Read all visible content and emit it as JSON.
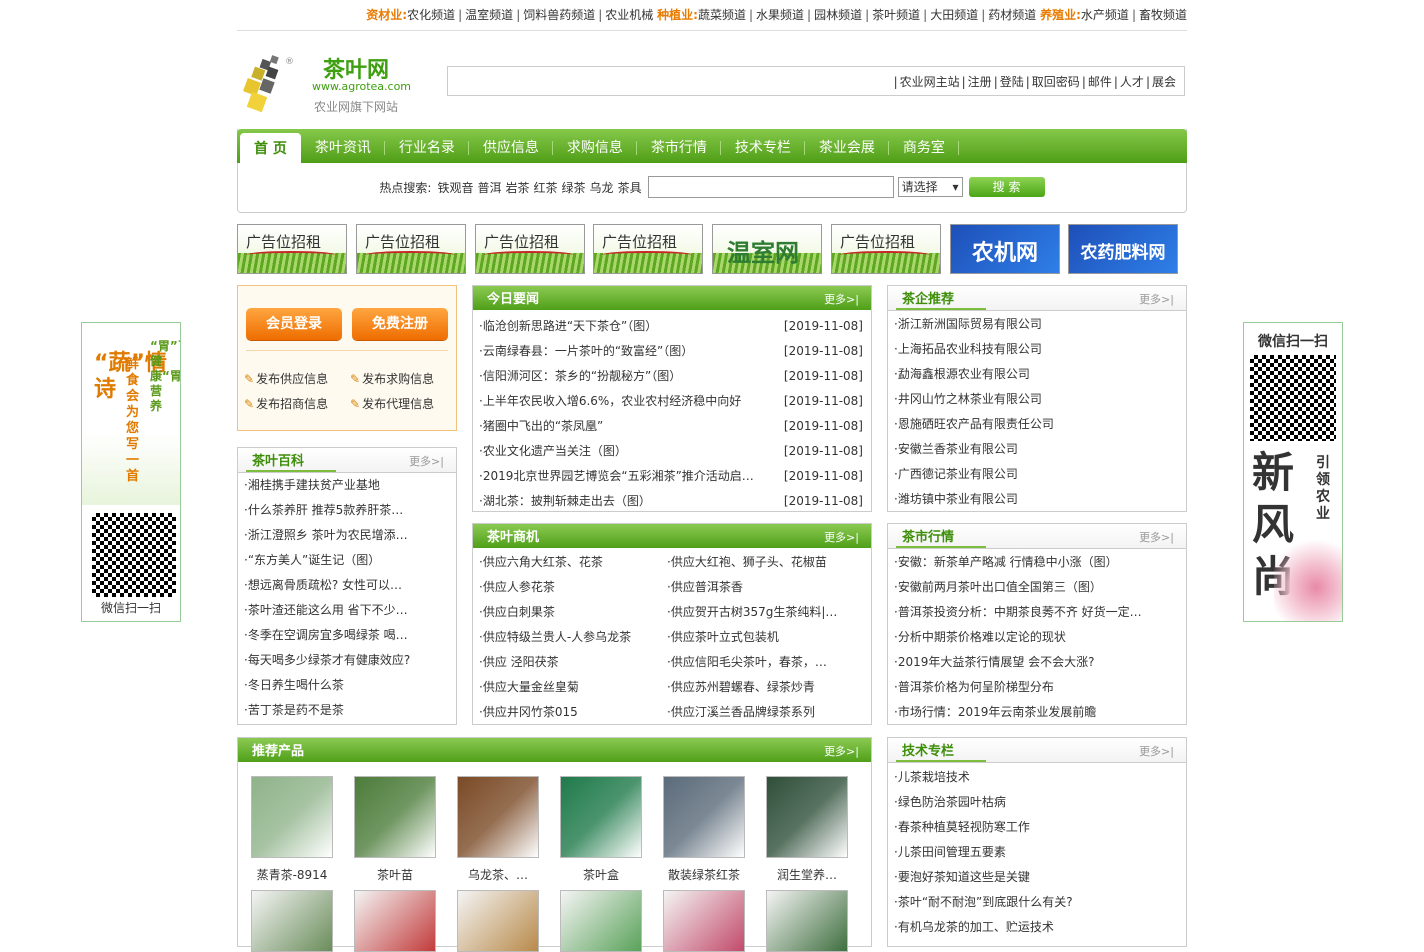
{
  "topbar": {
    "groups": [
      {
        "label": "资材业:",
        "items": [
          "农化频道",
          "温室频道",
          "饲料兽药频道",
          "农业机械"
        ]
      },
      {
        "label": "种植业:",
        "items": [
          "蔬菜频道",
          "水果频道",
          "园林频道",
          "茶叶频道",
          "大田频道",
          "药材频道"
        ]
      },
      {
        "label": "养殖业:",
        "items": [
          "水产频道",
          "畜牧频道"
        ]
      }
    ]
  },
  "header": {
    "title": "茶叶网",
    "url": "www.agrotea.com",
    "subtitle": "农业网旗下网站",
    "reg_mark": "®",
    "links": [
      "农业网主站",
      "注册",
      "登陆",
      "取回密码",
      "邮件",
      "人才",
      "展会"
    ]
  },
  "nav": {
    "items": [
      "首 页",
      "茶叶资讯",
      "行业名录",
      "供应信息",
      "求购信息",
      "茶市行情",
      "技术专栏",
      "茶业会展",
      "商务室"
    ],
    "hot_label": "热点搜索:",
    "hot_keywords": [
      "铁观音",
      "普洱",
      "岩茶",
      "红茶",
      "绿茶",
      "乌龙",
      "茶具"
    ],
    "search_value": "",
    "select_value": "请选择",
    "search_button": "搜 索"
  },
  "ads": [
    {
      "text": "广告位招租",
      "style": "green"
    },
    {
      "text": "广告位招租",
      "style": "green"
    },
    {
      "text": "广告位招租",
      "style": "green"
    },
    {
      "text": "广告位招租",
      "style": "green"
    },
    {
      "text": "温室网",
      "style": "wenshi"
    },
    {
      "text": "广告位招租",
      "style": "green"
    },
    {
      "text": "农机网",
      "style": "blue"
    },
    {
      "text": "农药肥料网",
      "style": "blue2"
    }
  ],
  "login": {
    "login_button": "会员登录",
    "register_button": "免费注册",
    "links": [
      "发布供应信息",
      "发布求购信息",
      "发布招商信息",
      "发布代理信息"
    ]
  },
  "more": "更多>|",
  "news": {
    "title": "今日要闻",
    "items": [
      {
        "t": "·临沧创新思路进“天下茶仓”（图）",
        "d": "[2019-11-08]"
      },
      {
        "t": "·云南绿春县：一片茶叶的“致富经”（图）",
        "d": "[2019-11-08]"
      },
      {
        "t": "·信阳浉河区：茶乡的“扮靓秘方”（图）",
        "d": "[2019-11-08]"
      },
      {
        "t": "·上半年农民收入增6.6%，农业农村经济稳中向好",
        "d": "[2019-11-08]"
      },
      {
        "t": "·猪圈中飞出的“茶凤凰”",
        "d": "[2019-11-08]"
      },
      {
        "t": "·农业文化遗产当关注（图）",
        "d": "[2019-11-08]"
      },
      {
        "t": "·2019北京世界园艺博览会“五彩湘茶”推介活动启…",
        "d": "[2019-11-08]"
      },
      {
        "t": "·湖北茶：披荆斩棘走出去（图）",
        "d": "[2019-11-08]"
      }
    ]
  },
  "enterprises": {
    "title": "茶企推荐",
    "items": [
      "·浙江新洲国际贸易有限公司",
      "·上海拓品农业科技有限公司",
      "·勐海鑫根源农业有限公司",
      "·井冈山竹之林茶业有限公司",
      "·恩施硒旺农产品有限责任公司",
      "·安徽兰香茶业有限公司",
      "·广西德记茶业有限公司",
      "·潍坊镇中茶业有限公司"
    ]
  },
  "encyclopedia": {
    "title": "茶叶百科",
    "items": [
      "·湘桂携手建扶贫产业基地",
      "·什么茶养肝 推荐5款养肝茶…",
      "·浙江澄照乡 茶叶为农民增添…",
      "·“东方美人”诞生记（图）",
      "·想远离骨质疏松? 女性可以…",
      "·茶叶渣还能这么用 省下不少…",
      "·冬季在空调房宜多喝绿茶 喝…",
      "·每天喝多少绿茶才有健康效应?",
      "·冬日养生喝什么茶",
      "·苦丁茶是药不是茶"
    ]
  },
  "merchants": {
    "title": "茶叶商机",
    "left": [
      "·供应六角大红茶、花茶",
      "·供应人参花茶",
      "·供应白刺果茶",
      "·供应特级兰贵人-人参乌龙茶",
      "·供应 泾阳茯茶",
      "·供应大量金丝皇菊",
      "·供应井冈竹茶015"
    ],
    "right": [
      "·供应大红袍、狮子头、花椒苗",
      "·供应普洱茶香",
      "·供应贺开古树357g生茶纯料|…",
      "·供应茶叶立式包装机",
      "·供应信阳毛尖茶叶，春茶，…",
      "·供应苏州碧螺春、绿茶炒青",
      "·供应汀溪兰香品牌绿茶系列"
    ]
  },
  "market": {
    "title": "茶市行情",
    "items": [
      "·安徽：新茶单产略减 行情稳中小涨（图）",
      "·安徽前两月茶叶出口值全国第三（图）",
      "·普洱茶投资分析：中期茶良莠不齐 好货一定…",
      "·分析中期茶价格难以定论的现状",
      "·2019年大益茶行情展望 会不会大涨?",
      "·普洱茶价格为何呈阶梯型分布",
      "·市场行情：2019年云南茶业发展前瞻"
    ]
  },
  "products": {
    "title": "推荐产品",
    "items": [
      {
        "name": "蒸青茶-8914",
        "color": "#8fb38a"
      },
      {
        "name": "茶叶苗",
        "color": "#4c7c3a"
      },
      {
        "name": "乌龙茶、…",
        "color": "#7a4a26"
      },
      {
        "name": "茶叶盒",
        "color": "#1f7a4a"
      },
      {
        "name": "散装绿茶红茶",
        "color": "#5b6b7a"
      },
      {
        "name": "润生堂养…",
        "color": "#2f4f3a"
      }
    ],
    "row2_colors": [
      "#6a8d5a",
      "#c23b3b",
      "#b88a4a",
      "#5aa25a",
      "#c24a6a",
      "#3f6f3f"
    ]
  },
  "tech": {
    "title": "技术专栏",
    "items": [
      "·儿茶栽培技术",
      "·绿色防治茶园叶枯病",
      "·春茶种植莫轻视防寒工作",
      "·儿茶田间管理五要素",
      "·要泡好茶知道这些是关键",
      "·茶叶“耐不耐泡”到底跟什么有关?",
      "·有机乌龙茶的加工、贮运技术"
    ]
  },
  "left_ad": {
    "poem_line1": "“胃”了健康“胃”了营养",
    "poem_line2": "鲜食会为您写一首",
    "poem_big": "“蔬”情诗",
    "caption": "微信扫一扫"
  },
  "right_ad": {
    "caption": "微信扫一扫",
    "big": "新风尚",
    "small": "引领农业"
  },
  "colors": {
    "accent": "#4f9e17",
    "orange": "#e87b00"
  }
}
